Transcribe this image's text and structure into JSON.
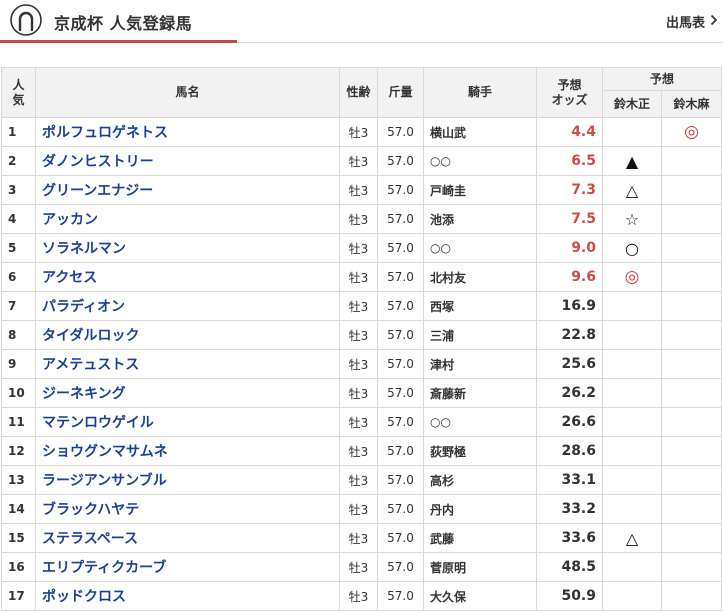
{
  "header": {
    "title": "京成杯 人気登録馬",
    "link_label": "出馬表",
    "accent_color": "#c9484d"
  },
  "table": {
    "columns": {
      "rank": "人気",
      "horse": "馬名",
      "sexage": "性齢",
      "weight": "斤量",
      "jockey": "騎手",
      "odds": "予想オッズ",
      "prediction_group": "予想",
      "pundit1": "鈴木正",
      "pundit2": "鈴木麻"
    },
    "rows": [
      {
        "rank": "1",
        "horse": "ポルフュロゲネトス",
        "sexage": "牡3",
        "weight": "57.0",
        "jockey": "横山武",
        "odds": "4.4",
        "hot": true,
        "m1": "",
        "m2": "◎"
      },
      {
        "rank": "2",
        "horse": "ダノンヒストリー",
        "sexage": "牡3",
        "weight": "57.0",
        "jockey": "○○",
        "odds": "6.5",
        "hot": true,
        "m1": "▲",
        "m2": ""
      },
      {
        "rank": "3",
        "horse": "グリーンエナジー",
        "sexage": "牡3",
        "weight": "57.0",
        "jockey": "戸崎圭",
        "odds": "7.3",
        "hot": true,
        "m1": "△",
        "m2": ""
      },
      {
        "rank": "4",
        "horse": "アッカン",
        "sexage": "牡3",
        "weight": "57.0",
        "jockey": "池添",
        "odds": "7.5",
        "hot": true,
        "m1": "☆",
        "m2": ""
      },
      {
        "rank": "5",
        "horse": "ソラネルマン",
        "sexage": "牡3",
        "weight": "57.0",
        "jockey": "○○",
        "odds": "9.0",
        "hot": true,
        "m1": "○",
        "m2": ""
      },
      {
        "rank": "6",
        "horse": "アクセス",
        "sexage": "牡3",
        "weight": "57.0",
        "jockey": "北村友",
        "odds": "9.6",
        "hot": true,
        "m1": "◎",
        "m2": ""
      },
      {
        "rank": "7",
        "horse": "パラディオン",
        "sexage": "牡3",
        "weight": "57.0",
        "jockey": "西塚",
        "odds": "16.9",
        "hot": false,
        "m1": "",
        "m2": ""
      },
      {
        "rank": "8",
        "horse": "タイダルロック",
        "sexage": "牡3",
        "weight": "57.0",
        "jockey": "三浦",
        "odds": "22.8",
        "hot": false,
        "m1": "",
        "m2": ""
      },
      {
        "rank": "9",
        "horse": "アメテュストス",
        "sexage": "牡3",
        "weight": "57.0",
        "jockey": "津村",
        "odds": "25.6",
        "hot": false,
        "m1": "",
        "m2": ""
      },
      {
        "rank": "10",
        "horse": "ジーネキング",
        "sexage": "牡3",
        "weight": "57.0",
        "jockey": "斎藤新",
        "odds": "26.2",
        "hot": false,
        "m1": "",
        "m2": ""
      },
      {
        "rank": "11",
        "horse": "マテンロウゲイル",
        "sexage": "牡3",
        "weight": "57.0",
        "jockey": "○○",
        "odds": "26.6",
        "hot": false,
        "m1": "",
        "m2": ""
      },
      {
        "rank": "12",
        "horse": "ショウグンマサムネ",
        "sexage": "牡3",
        "weight": "57.0",
        "jockey": "荻野極",
        "odds": "28.6",
        "hot": false,
        "m1": "",
        "m2": ""
      },
      {
        "rank": "13",
        "horse": "ラージアンサンブル",
        "sexage": "牡3",
        "weight": "57.0",
        "jockey": "高杉",
        "odds": "33.1",
        "hot": false,
        "m1": "",
        "m2": ""
      },
      {
        "rank": "14",
        "horse": "ブラックハヤテ",
        "sexage": "牡3",
        "weight": "57.0",
        "jockey": "丹内",
        "odds": "33.2",
        "hot": false,
        "m1": "",
        "m2": ""
      },
      {
        "rank": "15",
        "horse": "ステラスペース",
        "sexage": "牡3",
        "weight": "57.0",
        "jockey": "武藤",
        "odds": "33.6",
        "hot": false,
        "m1": "△",
        "m2": ""
      },
      {
        "rank": "16",
        "horse": "エリプティクカーブ",
        "sexage": "牡3",
        "weight": "57.0",
        "jockey": "菅原明",
        "odds": "48.5",
        "hot": false,
        "m1": "",
        "m2": ""
      },
      {
        "rank": "17",
        "horse": "ポッドクロス",
        "sexage": "牡3",
        "weight": "57.0",
        "jockey": "大久保",
        "odds": "50.9",
        "hot": false,
        "m1": "",
        "m2": ""
      }
    ]
  }
}
